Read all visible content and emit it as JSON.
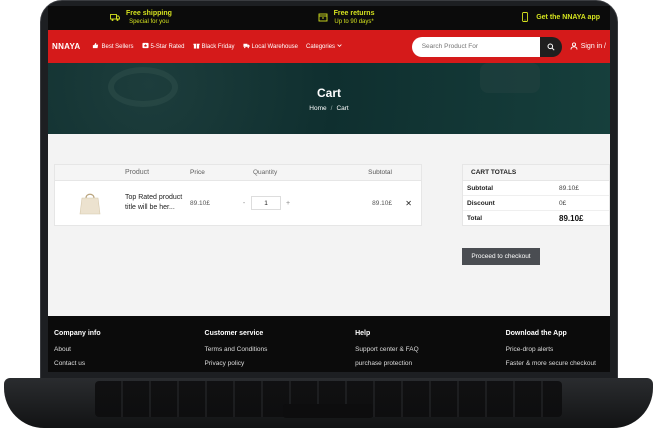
{
  "topbar": {
    "promos": [
      {
        "title": "Free shipping",
        "subtitle": "Special for you",
        "icon": "truck-icon"
      },
      {
        "title": "Free returns",
        "subtitle": "Up to 90 days*",
        "icon": "box-icon"
      },
      {
        "title": "Get the NNAYA app",
        "subtitle": "",
        "icon": "phone-icon"
      }
    ]
  },
  "header": {
    "logo": "NNAYA",
    "nav": [
      {
        "label": "Best Sellers",
        "icon": "thumbs-up-icon"
      },
      {
        "label": "5-Star Rated",
        "icon": "star-icon"
      },
      {
        "label": "Black Friday",
        "icon": "gift-icon"
      },
      {
        "label": "Local Warehouse",
        "icon": "truck-icon"
      },
      {
        "label": "Categories",
        "icon": "chevron-down-icon"
      }
    ],
    "search_placeholder": "Search Product For",
    "signin": "Sign in /"
  },
  "hero": {
    "title": "Cart",
    "breadcrumb": [
      "Home",
      "/",
      "Cart"
    ]
  },
  "cart": {
    "columns": [
      "Product",
      "Price",
      "Quantity",
      "Subtotal"
    ],
    "items": [
      {
        "name": "Top Rated product title will be her...",
        "price": "89.10£",
        "quantity": "1",
        "subtotal": "89.10£",
        "decrement": "-",
        "increment": "+",
        "remove": "✕"
      }
    ]
  },
  "totals": {
    "title": "CART TOTALS",
    "rows": [
      {
        "label": "Subtotal",
        "value": "89.10£"
      },
      {
        "label": "Discount",
        "value": "0£"
      },
      {
        "label": "Total",
        "value": "89.10£"
      }
    ],
    "checkout_label": "Proceed to checkout"
  },
  "footer": {
    "columns": [
      {
        "title": "Company info",
        "links": [
          "About",
          "Contact us"
        ]
      },
      {
        "title": "Customer service",
        "links": [
          "Terms and Conditions",
          "Privacy policy"
        ]
      },
      {
        "title": "Help",
        "links": [
          "Support center & FAQ",
          "purchase protection"
        ]
      },
      {
        "title": "Download the App",
        "links": [
          "Price-drop alerts",
          "Faster & more secure checkout"
        ]
      }
    ]
  },
  "colors": {
    "brand_red": "#d51a1a",
    "promo_yellow": "#d4e21f",
    "hero_teal": "#163f3c",
    "footer_black": "#0b0b0b"
  }
}
